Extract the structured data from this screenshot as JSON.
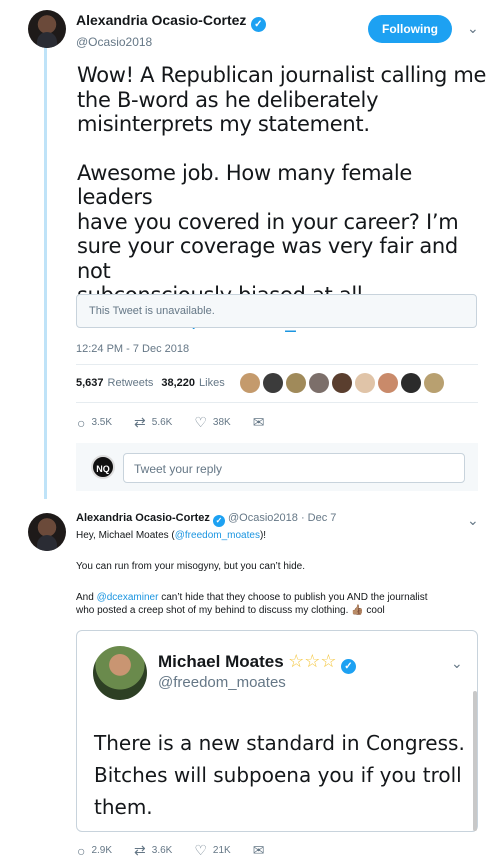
{
  "main_tweet": {
    "author_name": "Alexandria Ocasio-Cortez",
    "author_handle": "@Ocasio2018",
    "follow_label": "Following",
    "text_line1": "Wow! A Republican journalist calling me",
    "text_line2": "the B-word as he deliberately",
    "text_line3": "misinterprets my statement.",
    "text_line4": "Awesome job. How many female leaders",
    "text_line5": "have you covered in your career? I’m",
    "text_line6": "sure your coverage was very fair and not",
    "text_line7": "subconsciously biased at all.",
    "link_text": "twitter.com/freedom_moates …",
    "unavailable_text": "This Tweet is unavailable.",
    "timestamp": "12:24 PM - 7 Dec 2018",
    "retweets_count": "5,637",
    "retweets_label": "Retweets",
    "likes_count": "38,220",
    "likes_label": "Likes",
    "actions": {
      "reply_count": "3.5K",
      "retweet_count": "5.6K",
      "like_count": "38K"
    },
    "reply_placeholder": "Tweet your reply",
    "reply_avatar_text": "NQ"
  },
  "likers": [
    {
      "color": "#c49a6c"
    },
    {
      "color": "#3b3b3b"
    },
    {
      "color": "#a08a5a"
    },
    {
      "color": "#7c6f6a"
    },
    {
      "color": "#5a3e2e"
    },
    {
      "color": "#e0c4a8"
    },
    {
      "color": "#c98a6a"
    },
    {
      "color": "#2b2b2b"
    },
    {
      "color": "#b8a070"
    }
  ],
  "reply_tweet": {
    "author_name": "Alexandria Ocasio-Cortez",
    "author_handle": "@Ocasio2018",
    "date": "· Dec 7",
    "line1_prefix": "Hey, Michael Moates (",
    "line1_mention": "@freedom_moates",
    "line1_suffix": ")!",
    "line2": "You can run from your misogyny, but you can’t hide.",
    "line3_prefix": "And ",
    "line3_mention": "@dcexaminer",
    "line3_rest": " can’t hide that they choose to publish you AND the journalist",
    "line4": "who posted a creep shot of my behind to discuss my clothing. 👍🏽 cool",
    "quote": {
      "name": "Michael Moates",
      "stars": "☆☆☆",
      "handle": "@freedom_moates",
      "line1": "There is a new standard in Congress.",
      "line2": "Bitches will subpoena you if you troll",
      "line3": "them."
    },
    "actions": {
      "reply_count": "2.9K",
      "retweet_count": "3.6K",
      "like_count": "21K"
    }
  },
  "colors": {
    "accent": "#1da1f2",
    "link": "#1b95e0",
    "thread_line": "#bfe3f8"
  }
}
